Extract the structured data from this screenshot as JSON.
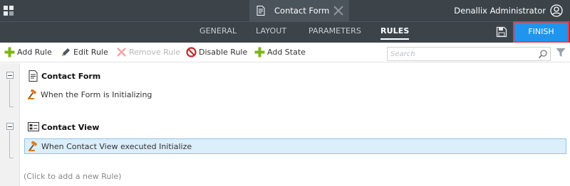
{
  "header": {
    "document_tab": {
      "title": "Contact Form",
      "icon": "form-document-icon",
      "close_icon": "close-x-icon"
    },
    "user": {
      "name": "Denallix Administrator",
      "icon": "user-avatar-icon"
    },
    "apps_icon": "apps-grid-icon"
  },
  "nav": {
    "tabs": [
      {
        "label": "GENERAL",
        "active": false
      },
      {
        "label": "LAYOUT",
        "active": false
      },
      {
        "label": "PARAMETERS",
        "active": false
      },
      {
        "label": "RULES",
        "active": true
      }
    ],
    "save_icon": "floppy-disk-icon",
    "finish_label": "FINISH"
  },
  "toolbar": {
    "items": [
      {
        "label": "Add Rule",
        "icon": "plus-icon",
        "enabled": true
      },
      {
        "label": "Edit Rule",
        "icon": "pencil-icon",
        "enabled": true
      },
      {
        "label": "Remove Rule",
        "icon": "x-icon",
        "enabled": false
      },
      {
        "label": "Disable Rule",
        "icon": "no-entry-icon",
        "enabled": true
      },
      {
        "label": "Add State",
        "icon": "plus-icon",
        "enabled": true
      }
    ],
    "search": {
      "placeholder": "Search",
      "value": ""
    },
    "filter_icon": "filter-funnel-icon"
  },
  "rules": {
    "groups": [
      {
        "title": "Contact Form",
        "icon": "form-document-icon",
        "rules": [
          {
            "label": "When the Form is Initializing",
            "icon": "gavel-icon",
            "selected": false
          }
        ]
      },
      {
        "title": "Contact View",
        "icon": "view-icon",
        "rules": [
          {
            "label": "When Contact View executed Initialize",
            "icon": "gavel-icon",
            "selected": true
          }
        ]
      }
    ],
    "add_rule_hint": "(Click to add a new Rule)"
  },
  "colors": {
    "header_bg": "#3c444a",
    "finish_bg": "#1f95ee",
    "finish_border": "#e23c47",
    "selected_row_bg": "#dbeefb",
    "add_icon_green": "#7cb518",
    "disable_icon_red": "#c8262f",
    "gavel_orange": "#e07b1a"
  }
}
